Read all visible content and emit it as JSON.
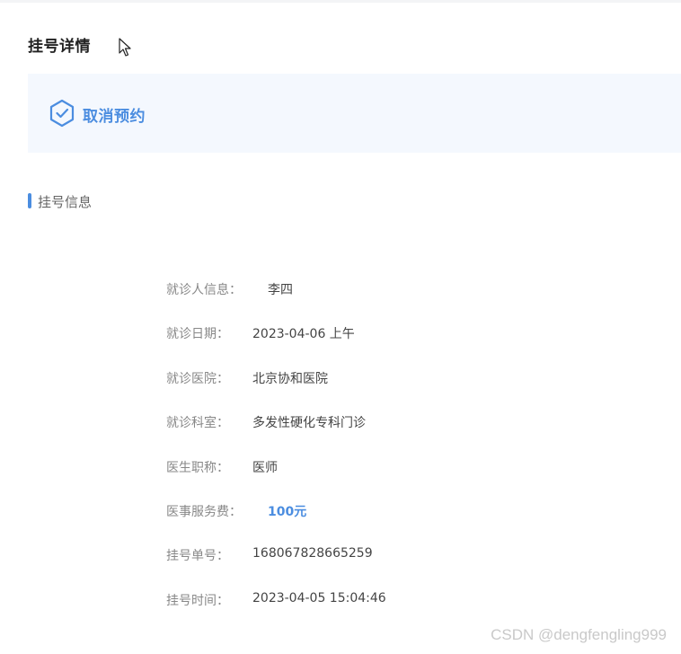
{
  "page": {
    "title": "挂号详情"
  },
  "status": {
    "text": "取消预约",
    "icon": "hexagon-check-icon",
    "accent_color": "#4b8de0",
    "background_color": "#f4f8fe"
  },
  "section": {
    "title": "挂号信息"
  },
  "info": [
    {
      "label": "就诊人信息：",
      "value": "李四"
    },
    {
      "label": "就诊日期：",
      "value": "2023-04-06 上午"
    },
    {
      "label": "就诊医院：",
      "value": "北京协和医院"
    },
    {
      "label": "就诊科室：",
      "value": "多发性硬化专科门诊"
    },
    {
      "label": "医生职称：",
      "value": "医师"
    },
    {
      "label": "医事服务费：",
      "value": "100元"
    },
    {
      "label": "挂号单号：",
      "value": "168067828665259"
    },
    {
      "label": "挂号时间：",
      "value": "2023-04-05 15:04:46"
    }
  ],
  "watermark": "CSDN @dengfengling999"
}
